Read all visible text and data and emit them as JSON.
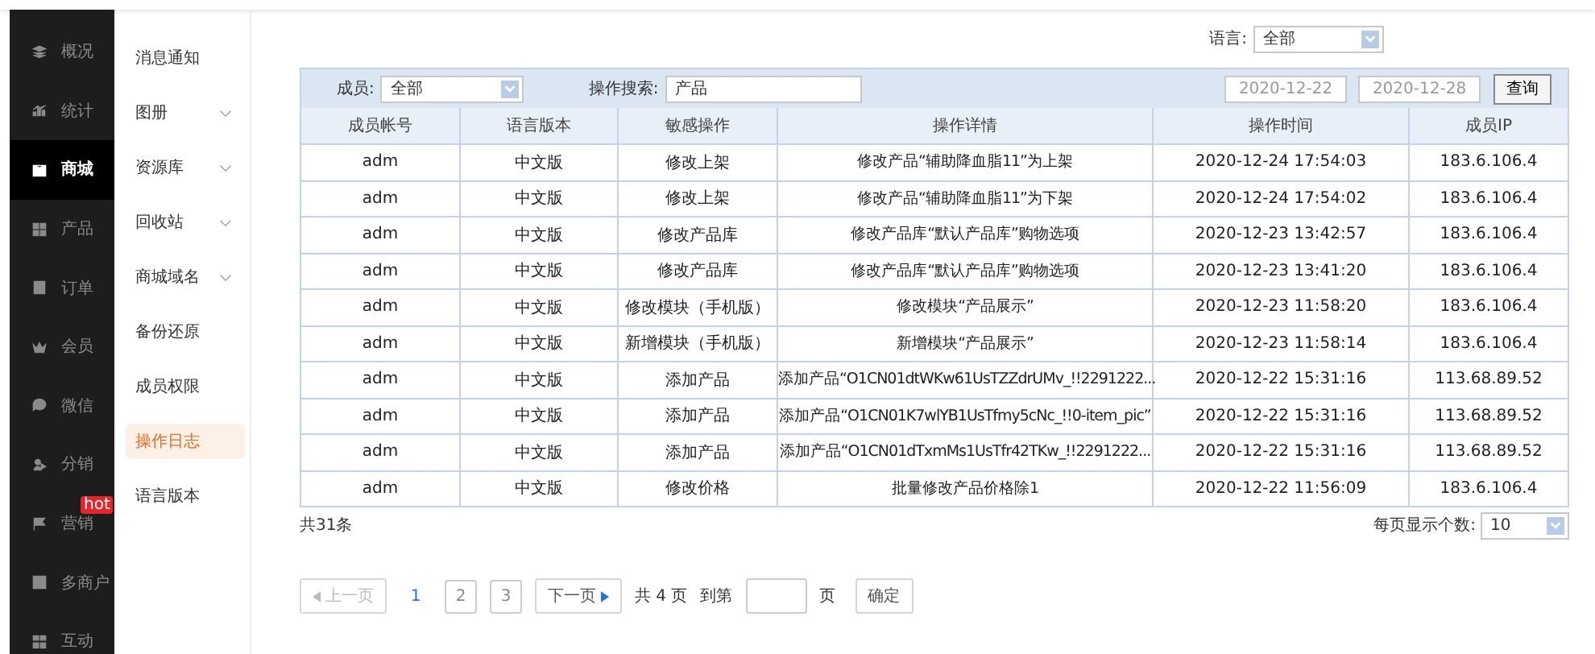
{
  "sidebar": {
    "items": [
      {
        "label": "概况",
        "selected": false
      },
      {
        "label": "统计",
        "selected": false
      },
      {
        "label": "商城",
        "selected": true
      },
      {
        "label": "产品",
        "selected": false
      },
      {
        "label": "订单",
        "selected": false
      },
      {
        "label": "会员",
        "selected": false
      },
      {
        "label": "微信",
        "selected": false
      },
      {
        "label": "分销",
        "selected": false
      },
      {
        "label": "营销",
        "selected": false,
        "badge": "hot"
      },
      {
        "label": "多商户",
        "selected": false
      },
      {
        "label": "互动",
        "selected": false
      }
    ]
  },
  "submenu": {
    "items": [
      {
        "label": "消息通知",
        "selected": false,
        "expandable": false
      },
      {
        "label": "图册",
        "selected": false,
        "expandable": true
      },
      {
        "label": "资源库",
        "selected": false,
        "expandable": true
      },
      {
        "label": "回收站",
        "selected": false,
        "expandable": true
      },
      {
        "label": "商城域名",
        "selected": false,
        "expandable": true
      },
      {
        "label": "备份还原",
        "selected": false,
        "expandable": false
      },
      {
        "label": "成员权限",
        "selected": false,
        "expandable": false
      },
      {
        "label": "操作日志",
        "selected": true,
        "expandable": false
      },
      {
        "label": "语言版本",
        "selected": false,
        "expandable": false
      }
    ]
  },
  "language_filter": {
    "label": "语言:",
    "value": "全部"
  },
  "filters": {
    "member_label": "成员:",
    "member_value": "全部",
    "search_label": "操作搜索:",
    "search_value": "产品",
    "date_from": "2020-12-22",
    "date_to": "2020-12-28",
    "query_button": "查询"
  },
  "table": {
    "columns": [
      "成员帐号",
      "语言版本",
      "敏感操作",
      "操作详情",
      "操作时间",
      "成员IP"
    ],
    "rows": [
      [
        "adm",
        "中文版",
        "修改上架",
        "修改产品“辅助降血脂11”为上架",
        "2020-12-24 17:54:03",
        "183.6.106.4"
      ],
      [
        "adm",
        "中文版",
        "修改上架",
        "修改产品“辅助降血脂11”为下架",
        "2020-12-24 17:54:02",
        "183.6.106.4"
      ],
      [
        "adm",
        "中文版",
        "修改产品库",
        "修改产品库“默认产品库”购物选项",
        "2020-12-23 13:42:57",
        "183.6.106.4"
      ],
      [
        "adm",
        "中文版",
        "修改产品库",
        "修改产品库“默认产品库”购物选项",
        "2020-12-23 13:41:20",
        "183.6.106.4"
      ],
      [
        "adm",
        "中文版",
        "修改模块（手机版）",
        "修改模块“产品展示”",
        "2020-12-23 11:58:20",
        "183.6.106.4"
      ],
      [
        "adm",
        "中文版",
        "新增模块（手机版）",
        "新增模块“产品展示”",
        "2020-12-23 11:58:14",
        "183.6.106.4"
      ],
      [
        "adm",
        "中文版",
        "添加产品",
        "添加产品“O1CN01dtWKw61UsTZZdrUMv_!!2291222...",
        "2020-12-22 15:31:16",
        "113.68.89.52"
      ],
      [
        "adm",
        "中文版",
        "添加产品",
        "添加产品“O1CN01K7wlYB1UsTfmy5cNc_!!0-item_pic”",
        "2020-12-22 15:31:16",
        "113.68.89.52"
      ],
      [
        "adm",
        "中文版",
        "添加产品",
        "添加产品“O1CN01dTxmMs1UsTfr42TKw_!!2291222...",
        "2020-12-22 15:31:16",
        "113.68.89.52"
      ],
      [
        "adm",
        "中文版",
        "修改价格",
        "批量修改产品价格除1",
        "2020-12-22 11:56:09",
        "183.6.106.4"
      ]
    ]
  },
  "total": "共31条",
  "page_size": {
    "label": "每页显示个数:",
    "value": "10"
  },
  "pagination": {
    "prev": "上一页",
    "prev_disabled": true,
    "pages": [
      {
        "label": "1",
        "selected": true
      },
      {
        "label": "2",
        "selected": false
      },
      {
        "label": "3",
        "selected": false
      }
    ],
    "next": "下一页",
    "total_pages": "共 4 页",
    "goto_label": "到第",
    "goto_suffix": "页",
    "confirm": "确定"
  }
}
